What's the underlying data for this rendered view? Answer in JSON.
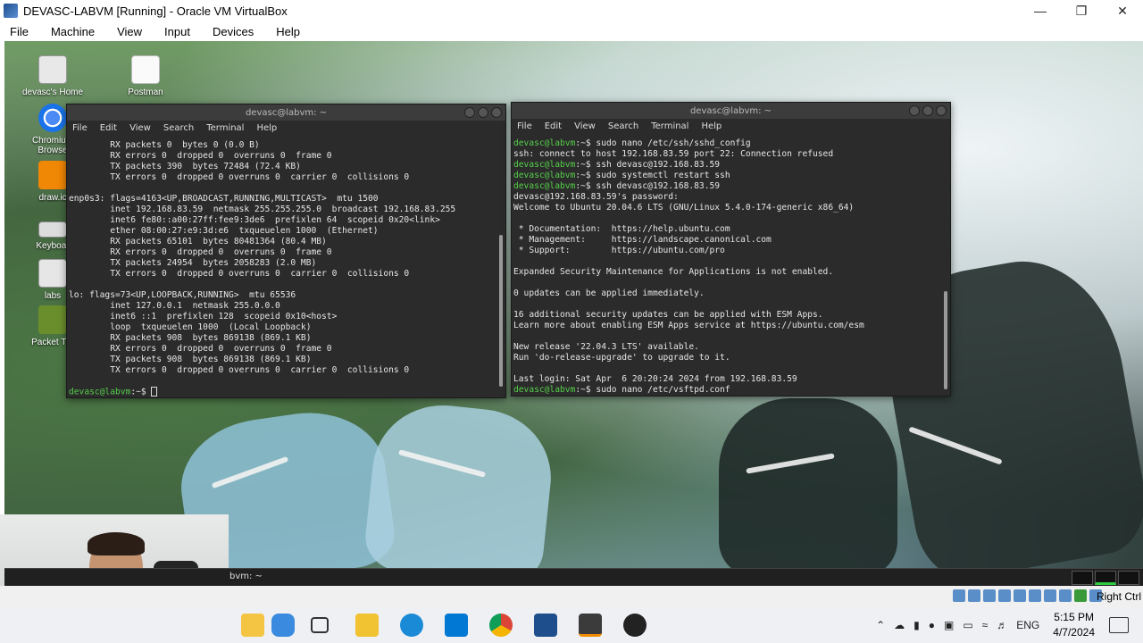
{
  "host": {
    "title": "DEVASC-LABVM [Running] - Oracle VM VirtualBox",
    "menu": [
      "File",
      "Machine",
      "View",
      "Input",
      "Devices",
      "Help"
    ],
    "window_controls": [
      "minimize-icon",
      "restore-icon",
      "close-icon"
    ]
  },
  "desktop_icons": [
    {
      "label": "devasc's Home",
      "icon": "home-folder-icon"
    },
    {
      "label": "Postman",
      "icon": "document-icon"
    },
    {
      "label": "Chromium Web Browser",
      "line1": "Chromium",
      "line2": "Browse",
      "icon": "chromium-icon"
    },
    {
      "label": "draw.io",
      "line1": "draw.ic",
      "icon": "drawio-icon"
    },
    {
      "label": "Keyboard",
      "line1": "Keyboar",
      "icon": "keyboard-icon"
    },
    {
      "label": "labs",
      "icon": "folder-icon"
    },
    {
      "label": "Packet Tracer",
      "line1": "Packet Tra",
      "icon": "packet-tracer-icon"
    }
  ],
  "terminal_left": {
    "title": "devasc@labvm: ~",
    "menu": [
      "File",
      "Edit",
      "View",
      "Search",
      "Terminal",
      "Help"
    ],
    "lines": [
      "        RX packets 0  bytes 0 (0.0 B)",
      "        RX errors 0  dropped 0  overruns 0  frame 0",
      "        TX packets 390  bytes 72484 (72.4 KB)",
      "        TX errors 0  dropped 0 overruns 0  carrier 0  collisions 0",
      "",
      "enp0s3: flags=4163<UP,BROADCAST,RUNNING,MULTICAST>  mtu 1500",
      "        inet 192.168.83.59  netmask 255.255.255.0  broadcast 192.168.83.255",
      "        inet6 fe80::a00:27ff:fee9:3de6  prefixlen 64  scopeid 0x20<link>",
      "        ether 08:00:27:e9:3d:e6  txqueuelen 1000  (Ethernet)",
      "        RX packets 65101  bytes 80481364 (80.4 MB)",
      "        RX errors 0  dropped 0  overruns 0  frame 0",
      "        TX packets 24954  bytes 2058283 (2.0 MB)",
      "        TX errors 0  dropped 0 overruns 0  carrier 0  collisions 0",
      "",
      "lo: flags=73<UP,LOOPBACK,RUNNING>  mtu 65536",
      "        inet 127.0.0.1  netmask 255.0.0.0",
      "        inet6 ::1  prefixlen 128  scopeid 0x10<host>",
      "        loop  txqueuelen 1000  (Local Loopback)",
      "        RX packets 908  bytes 869138 (869.1 KB)",
      "        RX errors 0  dropped 0  overruns 0  frame 0",
      "        TX packets 908  bytes 869138 (869.1 KB)",
      "        TX errors 0  dropped 0 overruns 0  carrier 0  collisions 0",
      ""
    ],
    "prompt_user": "devasc@labvm",
    "prompt_rest": ":~$ "
  },
  "terminal_right": {
    "title": "devasc@labvm: ~",
    "menu": [
      "File",
      "Edit",
      "View",
      "Search",
      "Terminal",
      "Help"
    ],
    "lines": [
      {
        "p": "devasc@labvm",
        "t": ":~$ sudo nano /etc/ssh/sshd_config"
      },
      {
        "t": "ssh: connect to host 192.168.83.59 port 22: Connection refused"
      },
      {
        "p": "devasc@labvm",
        "t": ":~$ ssh devasc@192.168.83.59"
      },
      {
        "p": "devasc@labvm",
        "t": ":~$ sudo systemctl restart ssh"
      },
      {
        "p": "devasc@labvm",
        "t": ":~$ ssh devasc@192.168.83.59"
      },
      {
        "t": "devasc@192.168.83.59's password:"
      },
      {
        "t": "Welcome to Ubuntu 20.04.6 LTS (GNU/Linux 5.4.0-174-generic x86_64)"
      },
      {
        "t": ""
      },
      {
        "t": " * Documentation:  https://help.ubuntu.com"
      },
      {
        "t": " * Management:     https://landscape.canonical.com"
      },
      {
        "t": " * Support:        https://ubuntu.com/pro"
      },
      {
        "t": ""
      },
      {
        "t": "Expanded Security Maintenance for Applications is not enabled."
      },
      {
        "t": ""
      },
      {
        "t": "0 updates can be applied immediately."
      },
      {
        "t": ""
      },
      {
        "t": "16 additional security updates can be applied with ESM Apps."
      },
      {
        "t": "Learn more about enabling ESM Apps service at https://ubuntu.com/esm"
      },
      {
        "t": ""
      },
      {
        "t": "New release '22.04.3 LTS' available."
      },
      {
        "t": "Run 'do-release-upgrade' to upgrade to it."
      },
      {
        "t": ""
      },
      {
        "t": "Last login: Sat Apr  6 20:20:24 2024 from 192.168.83.59"
      },
      {
        "p": "devasc@labvm",
        "t": ":~$ sudo nano /etc/vsftpd.conf"
      }
    ]
  },
  "guest_panel": {
    "task_label": "bvm: ~"
  },
  "vbox_status": {
    "host_key": "Right Ctrl"
  },
  "taskbar": {
    "apps": [
      "notes-app-icon",
      "app-bottle-icon",
      "task-view-icon",
      "file-explorer-icon",
      "edge-icon",
      "vscode-icon",
      "chrome-icon",
      "virtualbox-icon",
      "sublime-icon",
      "recorder-icon"
    ],
    "tray": {
      "language": "ENG",
      "time": "5:15 PM",
      "date": "4/7/2024"
    }
  },
  "colors": {
    "prompt_green": "#55d04a",
    "terminal_bg": "#2b2b2b",
    "terminal_text": "#e6e6e6"
  }
}
